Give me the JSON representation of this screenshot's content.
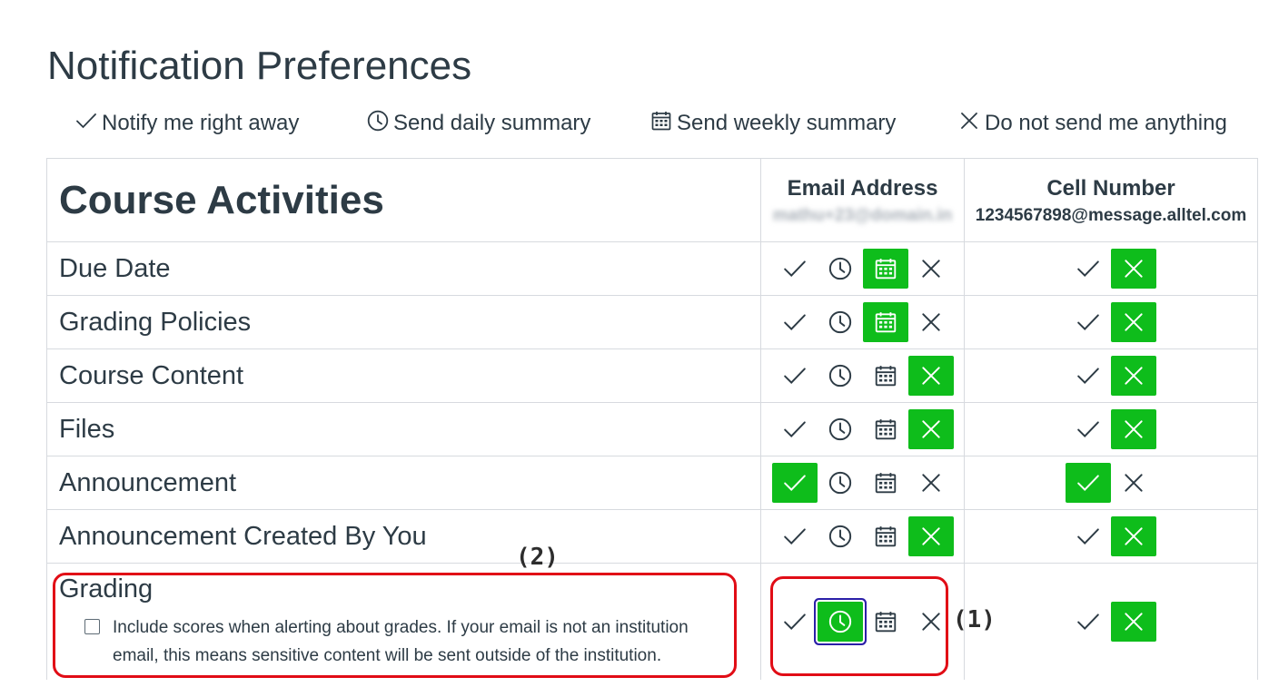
{
  "page_title": "Notification Preferences",
  "legend": {
    "immediately": "Notify me right away",
    "daily": "Send daily summary",
    "weekly": "Send weekly summary",
    "never": "Do not send me anything"
  },
  "category_title": "Course Activities",
  "channels": [
    {
      "label": "Email Address",
      "address": "mathu+23@domain.in",
      "address_obscured": true
    },
    {
      "label": "Cell Number",
      "address": "1234567898@message.alltel.com",
      "address_obscured": false
    }
  ],
  "option_icons": [
    "check-icon",
    "clock-icon",
    "calendar-icon",
    "x-icon"
  ],
  "rows": [
    {
      "name": "Due Date",
      "email": "weekly",
      "cell": "never"
    },
    {
      "name": "Grading Policies",
      "email": "weekly",
      "cell": "never"
    },
    {
      "name": "Course Content",
      "email": "never",
      "cell": "never"
    },
    {
      "name": "Files",
      "email": "never",
      "cell": "never"
    },
    {
      "name": "Announcement",
      "email": "immediately",
      "cell": "immediately"
    },
    {
      "name": "Announcement Created By You",
      "email": "never",
      "cell": "never"
    },
    {
      "name": "Grading",
      "email": "daily",
      "cell": "never",
      "checkbox_label": "Include scores when alerting about grades. If your email is not an institution email, this means sensitive content will be sent outside of the institution.",
      "checkbox_checked": false
    }
  ],
  "annotations": [
    "(1)",
    "(2)"
  ],
  "colors": {
    "selected": "#0ebd1b",
    "focus_ring": "#2b1fa8",
    "annotation": "#e10d16",
    "text": "#2d3b45"
  }
}
